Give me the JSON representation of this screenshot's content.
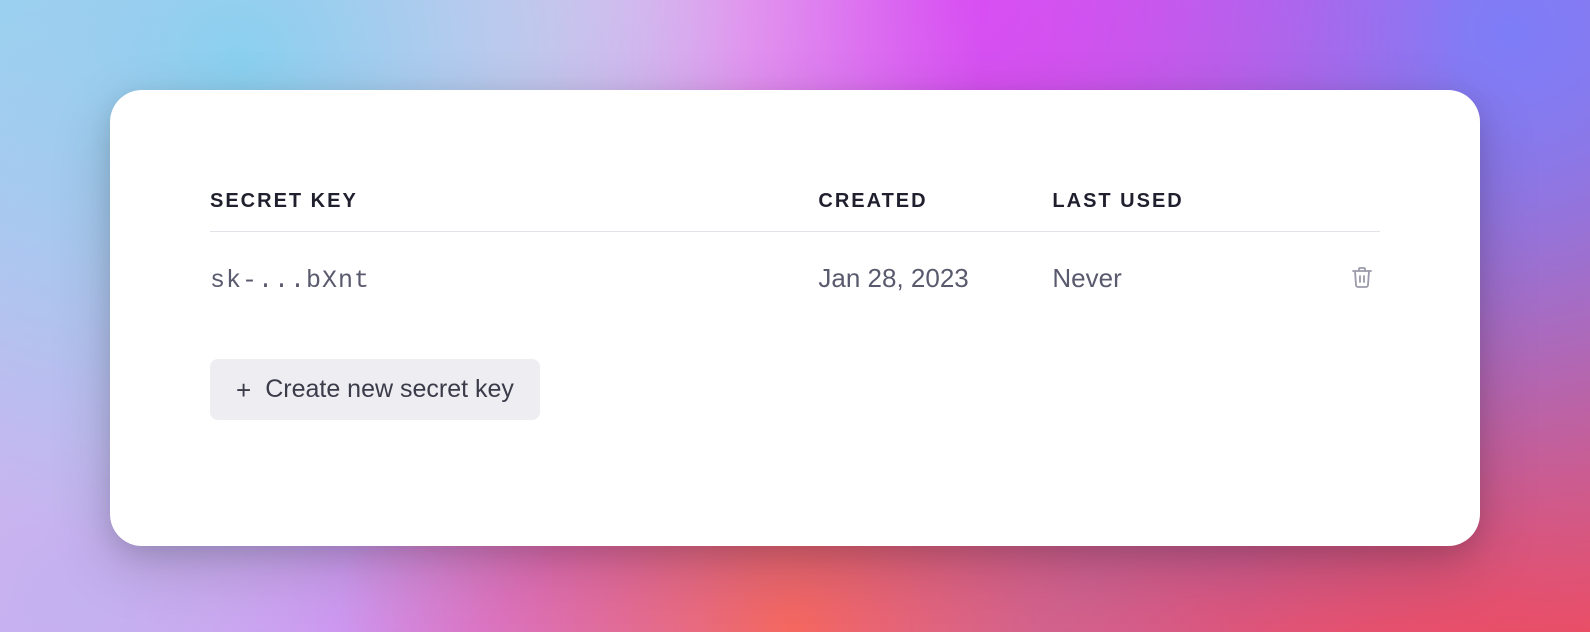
{
  "table": {
    "headers": {
      "secret_key": "SECRET KEY",
      "created": "CREATED",
      "last_used": "LAST USED"
    },
    "rows": [
      {
        "key": "sk-...bXnt",
        "created": "Jan 28, 2023",
        "last_used": "Never"
      }
    ]
  },
  "actions": {
    "create_label": "Create new secret key"
  }
}
